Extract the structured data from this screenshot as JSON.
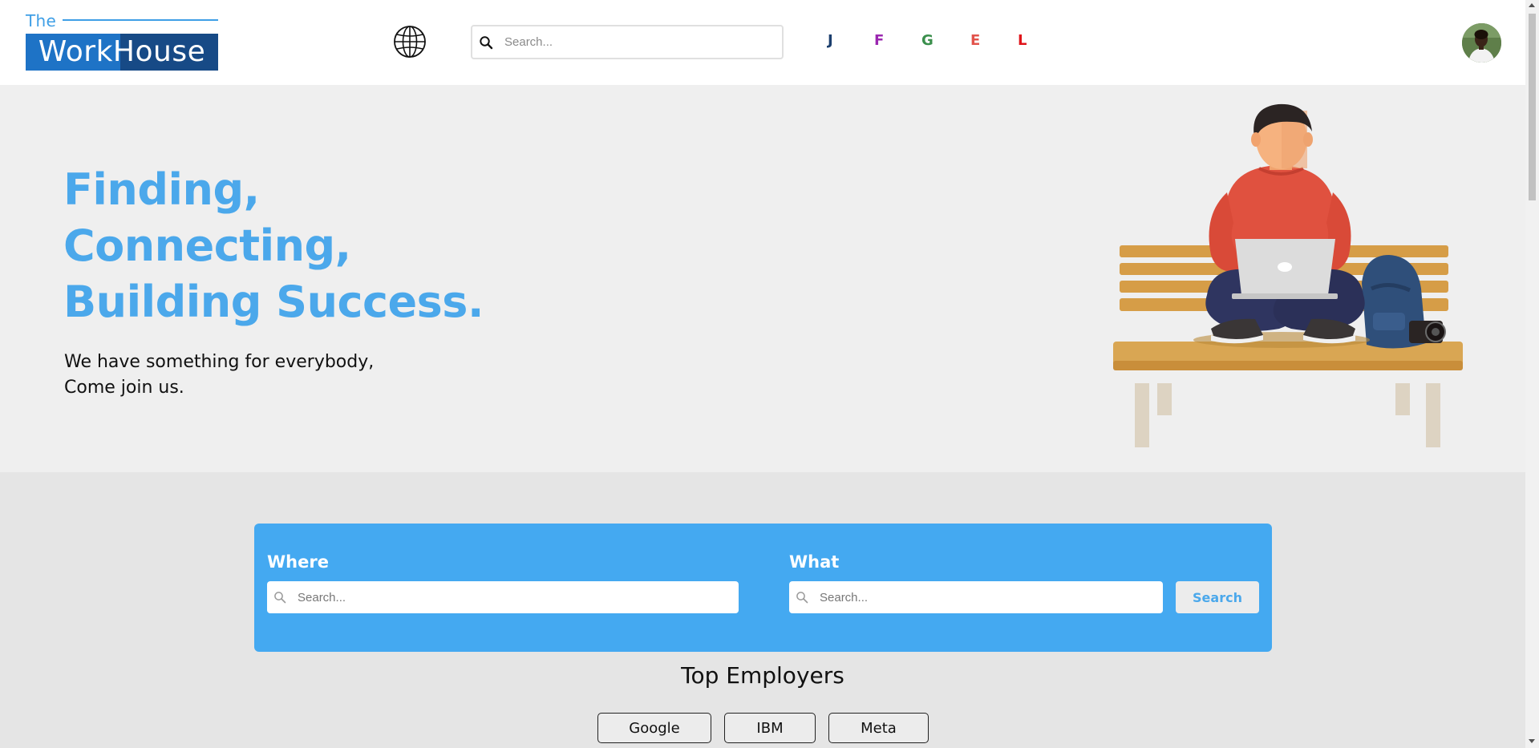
{
  "header": {
    "logo": {
      "top_text": "The",
      "main_text": "WorkHouse"
    },
    "search": {
      "placeholder": "Search..."
    },
    "letters": [
      {
        "label": "J",
        "color": "#1c3f6e"
      },
      {
        "label": "F",
        "color": "#9b27b0"
      },
      {
        "label": "G",
        "color": "#3a8f4c"
      },
      {
        "label": "E",
        "color": "#e2534b"
      },
      {
        "label": "L",
        "color": "#e0141a"
      }
    ],
    "icons": {
      "language": "globe-icon",
      "search": "search-icon",
      "profile": "avatar"
    }
  },
  "hero": {
    "title_lines": [
      "Finding,",
      "Connecting,",
      "Building Success."
    ],
    "subtitle_lines": [
      "We have something for everybody,",
      "Come join us."
    ],
    "title_color": "#4ba8eb"
  },
  "search_panel": {
    "where_label": "Where",
    "where_placeholder": "Search...",
    "what_label": "What",
    "what_placeholder": "Search...",
    "button_label": "Search",
    "background": "#44a9f1"
  },
  "employers": {
    "title": "Top Employers",
    "items": [
      "Google",
      "IBM",
      "Meta"
    ]
  }
}
